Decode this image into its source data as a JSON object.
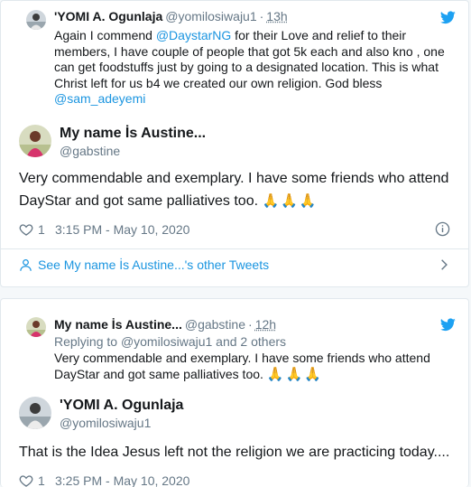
{
  "tweet1": {
    "quoted": {
      "name": "'YOMI A. Ogunlaja",
      "handle": "@yomilosiwaju1",
      "time": "13h",
      "text_parts": {
        "p1": "Again I commend ",
        "mention1": "@DaystarNG",
        "p2": " for their Love and relief to their members, I have couple of people that got 5k each and also kno , one can get foodstuffs just by going to a designated location. This is what Christ left for us b4 we created our own religion. God bless ",
        "mention2": "@sam_adeyemi"
      }
    },
    "author": {
      "name": "My name İs Austine...",
      "handle": "@gabstine"
    },
    "text": "Very commendable and exemplary. I have some friends who attend DayStar and got same palliatives too.",
    "emoji": "🙏🙏🙏",
    "likes": "1",
    "timestamp": "3:15 PM - May 10, 2020",
    "see_more": "See My name İs Austine...'s other Tweets"
  },
  "tweet2": {
    "quoted": {
      "name": "My name İs Austine...",
      "handle": "@gabstine",
      "time": "12h",
      "replying_prefix": "Replying to ",
      "replying_handle": "@yomilosiwaju1",
      "replying_suffix": " and 2 others",
      "text": "Very commendable and exemplary. I have some friends who attend DayStar and got same palliatives too.",
      "emoji": "🙏🙏🙏"
    },
    "author": {
      "name": "'YOMI A. Ogunlaja",
      "handle": "@yomilosiwaju1"
    },
    "text": "That is the Idea Jesus left not the religion we are practicing today....",
    "likes": "1",
    "timestamp": "3:25 PM - May 10, 2020"
  },
  "colors": {
    "link": "#1b95e0",
    "muted": "#657786",
    "text": "#14171a",
    "border": "#e1e8ed"
  },
  "icons": [
    "twitter-bird-icon",
    "heart-icon",
    "info-icon",
    "person-icon",
    "chevron-right-icon"
  ],
  "separator": "·"
}
